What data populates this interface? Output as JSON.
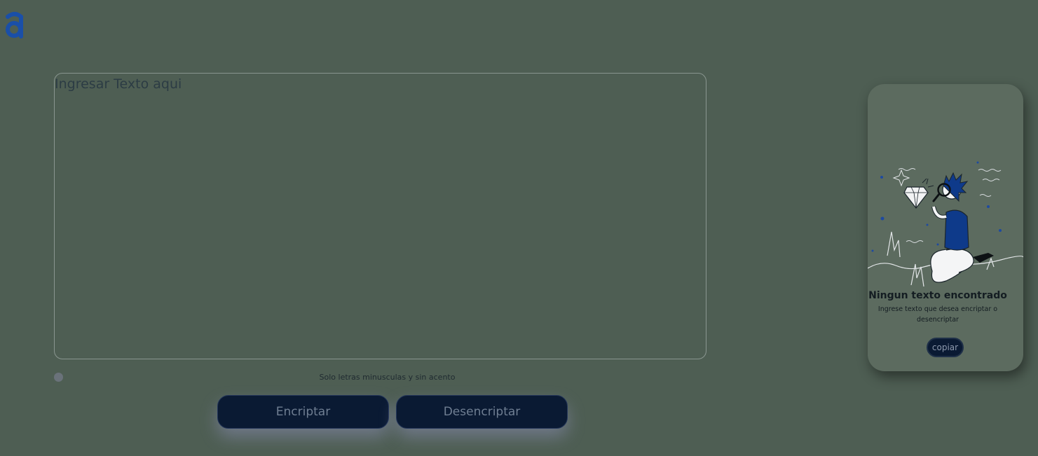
{
  "logo": {
    "letter": "a",
    "color": "#1a4fa8"
  },
  "editor": {
    "placeholder": "Ingresar Texto aqui",
    "value": ""
  },
  "hint": {
    "text": "Solo letras minusculas y sin acento"
  },
  "buttons": {
    "encrypt": "Encriptar",
    "decrypt": "Desencriptar"
  },
  "output": {
    "title": "Ningun texto encontrado",
    "subtitle": "Ingrese texto que desea encriptar o desencriptar",
    "copy": "copiar"
  },
  "colors": {
    "background": "#4e5e53",
    "card": "#5c6b5f",
    "button": "#0a1a33",
    "accent": "#0e3a8a"
  }
}
